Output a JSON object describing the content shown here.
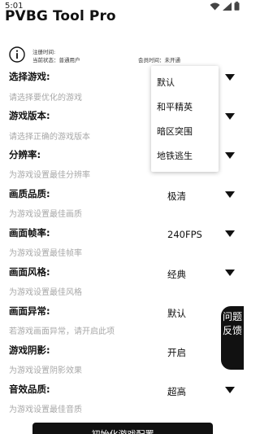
{
  "status_bar": {
    "time": "5:01",
    "icons": [
      "wifi-icon",
      "signal-icon",
      "battery-icon"
    ]
  },
  "app": {
    "title": "PVBG Tool Pro",
    "accent_color": "#111111"
  },
  "info": {
    "icon": "info-icon",
    "register_time": "注册时间:",
    "current_status": "当前状态：普通用户",
    "member_time": "会员时间：未开通"
  },
  "settings": [
    {
      "label": "选择游戏:",
      "hint": "请选择要优化的游戏",
      "value": ""
    },
    {
      "label": "游戏版本:",
      "hint": "请选择正确的游戏版本",
      "value": ""
    },
    {
      "label": "分辨率:",
      "hint": "为游戏设置最佳分辨率",
      "value": ""
    },
    {
      "label": "画质品质:",
      "hint": "为游戏设置最佳画质",
      "value": "极清"
    },
    {
      "label": "画面帧率:",
      "hint": "为游戏设置最佳帧率",
      "value": "240FPS"
    },
    {
      "label": "画面风格:",
      "hint": "为游戏设置最佳风格",
      "value": "经典"
    },
    {
      "label": "画面异常:",
      "hint": "若游戏画面异常，请开启此项",
      "value": "默认"
    },
    {
      "label": "游戏阴影:",
      "hint": "为游戏设置阴影效果",
      "value": "开启"
    },
    {
      "label": "音效品质:",
      "hint": "为游戏设置最佳音质",
      "value": "超高"
    }
  ],
  "game_dropdown": {
    "options": [
      "默认",
      "和平精英",
      "暗区突围",
      "地铁逃生"
    ]
  },
  "feedback": {
    "label": "问题反馈"
  },
  "bottom_button": {
    "label": "初始化游戏配置"
  }
}
